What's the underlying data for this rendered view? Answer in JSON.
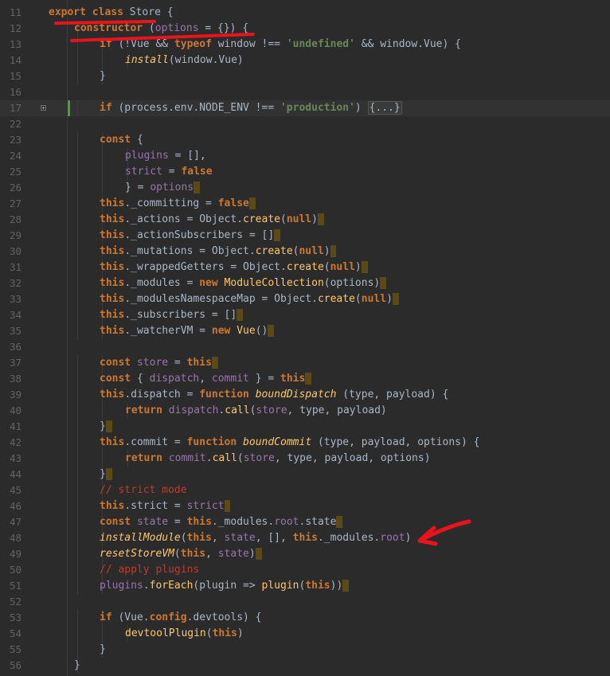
{
  "colors": {
    "background": "#2b2b2b",
    "keyword": "#cc7832",
    "string": "#6a8759",
    "function": "#ffc66d",
    "property": "#9876aa",
    "default_text": "#a9b7c6",
    "comment": "#bc3b2f",
    "line_number": "#606366",
    "annotation": "#e8131c"
  },
  "annotations": {
    "underline_class_label": "red underline",
    "underline_constructor_label": "red underline",
    "arrow_icon": "red-arrow-icon"
  },
  "lines": [
    {
      "num": "11",
      "indent": 0,
      "current": false,
      "tokens": [
        {
          "c": "k",
          "t": "export"
        },
        {
          "t": " "
        },
        {
          "c": "k",
          "t": "class"
        },
        {
          "t": " Store {"
        }
      ]
    },
    {
      "num": "12",
      "indent": 1,
      "current": false,
      "tokens": [
        {
          "c": "k",
          "t": "constructor"
        },
        {
          "t": " ("
        },
        {
          "c": "pr",
          "t": "options"
        },
        {
          "t": " = {}) {"
        }
      ]
    },
    {
      "num": "13",
      "indent": 2,
      "current": false,
      "tokens": [
        {
          "c": "k",
          "t": "if"
        },
        {
          "t": " (!Vue && "
        },
        {
          "c": "k",
          "t": "typeof"
        },
        {
          "t": " window !== "
        },
        {
          "c": "s",
          "t": "'undefined'"
        },
        {
          "t": " && window.Vue) {"
        }
      ]
    },
    {
      "num": "14",
      "indent": 3,
      "current": false,
      "tokens": [
        {
          "c": "fn it",
          "t": "install"
        },
        {
          "t": "(window.Vue)"
        }
      ]
    },
    {
      "num": "15",
      "indent": 2,
      "current": false,
      "tokens": [
        {
          "t": "}"
        }
      ]
    },
    {
      "num": "16",
      "indent": 0,
      "current": false,
      "tokens": []
    },
    {
      "num": "17",
      "indent": 2,
      "current": true,
      "fold": true,
      "change": true,
      "tokens": [
        {
          "c": "k",
          "t": "if"
        },
        {
          "t": " (process.env.NODE_ENV !== "
        },
        {
          "c": "s",
          "t": "'production'"
        },
        {
          "t": ") "
        },
        {
          "c": "fold-block",
          "t": "{...}"
        }
      ]
    },
    {
      "num": "22",
      "indent": 0,
      "current": false,
      "tokens": []
    },
    {
      "num": "23",
      "indent": 2,
      "current": false,
      "tokens": [
        {
          "c": "k",
          "t": "const"
        },
        {
          "t": " {"
        }
      ]
    },
    {
      "num": "24",
      "indent": 3,
      "current": false,
      "tokens": [
        {
          "c": "pr",
          "t": "plugins"
        },
        {
          "t": " = [],"
        }
      ]
    },
    {
      "num": "25",
      "indent": 3,
      "current": false,
      "tokens": [
        {
          "c": "pr",
          "t": "strict"
        },
        {
          "t": " = "
        },
        {
          "c": "k",
          "t": "false"
        }
      ]
    },
    {
      "num": "26",
      "indent": 3,
      "current": false,
      "tokens": [
        {
          "t": "} = "
        },
        {
          "c": "pr",
          "t": "options"
        },
        {
          "c": "ws",
          "t": " "
        }
      ]
    },
    {
      "num": "27",
      "indent": 2,
      "current": false,
      "tokens": [
        {
          "c": "k",
          "t": "this"
        },
        {
          "t": "._committing = "
        },
        {
          "c": "k",
          "t": "false"
        },
        {
          "c": "ws",
          "t": " "
        }
      ]
    },
    {
      "num": "28",
      "indent": 2,
      "current": false,
      "tokens": [
        {
          "c": "k",
          "t": "this"
        },
        {
          "t": "._actions = Object."
        },
        {
          "c": "fn",
          "t": "create"
        },
        {
          "t": "("
        },
        {
          "c": "k",
          "t": "null"
        },
        {
          "t": ")"
        },
        {
          "c": "ws",
          "t": " "
        }
      ]
    },
    {
      "num": "29",
      "indent": 2,
      "current": false,
      "tokens": [
        {
          "c": "k",
          "t": "this"
        },
        {
          "t": "._actionSubscribers = []"
        },
        {
          "c": "ws",
          "t": " "
        }
      ]
    },
    {
      "num": "30",
      "indent": 2,
      "current": false,
      "tokens": [
        {
          "c": "k",
          "t": "this"
        },
        {
          "t": "._mutations = Object."
        },
        {
          "c": "fn",
          "t": "create"
        },
        {
          "t": "("
        },
        {
          "c": "k",
          "t": "null"
        },
        {
          "t": ")"
        },
        {
          "c": "ws",
          "t": " "
        }
      ]
    },
    {
      "num": "31",
      "indent": 2,
      "current": false,
      "tokens": [
        {
          "c": "k",
          "t": "this"
        },
        {
          "t": "._wrappedGetters = Object."
        },
        {
          "c": "fn",
          "t": "create"
        },
        {
          "t": "("
        },
        {
          "c": "k",
          "t": "null"
        },
        {
          "t": ")"
        },
        {
          "c": "ws",
          "t": " "
        }
      ]
    },
    {
      "num": "32",
      "indent": 2,
      "current": false,
      "tokens": [
        {
          "c": "k",
          "t": "this"
        },
        {
          "t": "._modules = "
        },
        {
          "c": "k",
          "t": "new"
        },
        {
          "t": " "
        },
        {
          "c": "fn",
          "t": "ModuleCollection"
        },
        {
          "t": "(options)"
        },
        {
          "c": "ws",
          "t": " "
        }
      ]
    },
    {
      "num": "33",
      "indent": 2,
      "current": false,
      "tokens": [
        {
          "c": "k",
          "t": "this"
        },
        {
          "t": "._modulesNamespaceMap = Object."
        },
        {
          "c": "fn",
          "t": "create"
        },
        {
          "t": "("
        },
        {
          "c": "k",
          "t": "null"
        },
        {
          "t": ")"
        },
        {
          "c": "ws",
          "t": " "
        }
      ]
    },
    {
      "num": "34",
      "indent": 2,
      "current": false,
      "tokens": [
        {
          "c": "k",
          "t": "this"
        },
        {
          "t": "._subscribers = []"
        },
        {
          "c": "ws",
          "t": " "
        }
      ]
    },
    {
      "num": "35",
      "indent": 2,
      "current": false,
      "tokens": [
        {
          "c": "k",
          "t": "this"
        },
        {
          "t": "._watcherVM = "
        },
        {
          "c": "k",
          "t": "new"
        },
        {
          "t": " "
        },
        {
          "c": "fn",
          "t": "Vue"
        },
        {
          "t": "()"
        },
        {
          "c": "ws",
          "t": " "
        }
      ]
    },
    {
      "num": "36",
      "indent": 0,
      "current": false,
      "tokens": []
    },
    {
      "num": "37",
      "indent": 2,
      "current": false,
      "tokens": [
        {
          "c": "k",
          "t": "const"
        },
        {
          "t": " "
        },
        {
          "c": "pr",
          "t": "store"
        },
        {
          "t": " = "
        },
        {
          "c": "k",
          "t": "this"
        },
        {
          "c": "ws",
          "t": " "
        }
      ]
    },
    {
      "num": "38",
      "indent": 2,
      "current": false,
      "tokens": [
        {
          "c": "k",
          "t": "const"
        },
        {
          "t": " { "
        },
        {
          "c": "pr",
          "t": "dispatch"
        },
        {
          "t": ", "
        },
        {
          "c": "pr",
          "t": "commit"
        },
        {
          "t": " } = "
        },
        {
          "c": "k",
          "t": "this"
        },
        {
          "c": "ws",
          "t": " "
        }
      ]
    },
    {
      "num": "39",
      "indent": 2,
      "current": false,
      "tokens": [
        {
          "c": "k",
          "t": "this"
        },
        {
          "t": ".dispatch = "
        },
        {
          "c": "k",
          "t": "function"
        },
        {
          "t": " "
        },
        {
          "c": "fn it",
          "t": "boundDispatch"
        },
        {
          "t": " (type, payload) {"
        }
      ]
    },
    {
      "num": "40",
      "indent": 3,
      "current": false,
      "tokens": [
        {
          "c": "k",
          "t": "return"
        },
        {
          "t": " "
        },
        {
          "c": "pr",
          "t": "dispatch"
        },
        {
          "t": "."
        },
        {
          "c": "fn",
          "t": "call"
        },
        {
          "t": "("
        },
        {
          "c": "pr",
          "t": "store"
        },
        {
          "t": ", type, payload)"
        }
      ]
    },
    {
      "num": "41",
      "indent": 2,
      "current": false,
      "tokens": [
        {
          "t": "}"
        },
        {
          "c": "ws",
          "t": " "
        }
      ]
    },
    {
      "num": "42",
      "indent": 2,
      "current": false,
      "tokens": [
        {
          "c": "k",
          "t": "this"
        },
        {
          "t": ".commit = "
        },
        {
          "c": "k",
          "t": "function"
        },
        {
          "t": " "
        },
        {
          "c": "fn it",
          "t": "boundCommit"
        },
        {
          "t": " (type, payload, options) {"
        }
      ]
    },
    {
      "num": "43",
      "indent": 3,
      "current": false,
      "tokens": [
        {
          "c": "k",
          "t": "return"
        },
        {
          "t": " "
        },
        {
          "c": "pr",
          "t": "commit"
        },
        {
          "t": "."
        },
        {
          "c": "fn",
          "t": "call"
        },
        {
          "t": "("
        },
        {
          "c": "pr",
          "t": "store"
        },
        {
          "t": ", type, payload, options)"
        }
      ]
    },
    {
      "num": "44",
      "indent": 2,
      "current": false,
      "tokens": [
        {
          "t": "}"
        },
        {
          "c": "ws",
          "t": " "
        }
      ]
    },
    {
      "num": "45",
      "indent": 2,
      "current": false,
      "tokens": [
        {
          "c": "cm",
          "t": "// strict mode"
        }
      ]
    },
    {
      "num": "46",
      "indent": 2,
      "current": false,
      "tokens": [
        {
          "c": "k",
          "t": "this"
        },
        {
          "t": ".strict = "
        },
        {
          "c": "pr",
          "t": "strict"
        },
        {
          "c": "ws",
          "t": " "
        }
      ]
    },
    {
      "num": "47",
      "indent": 2,
      "current": false,
      "tokens": [
        {
          "c": "k",
          "t": "const"
        },
        {
          "t": " "
        },
        {
          "c": "pr",
          "t": "state"
        },
        {
          "t": " = "
        },
        {
          "c": "k",
          "t": "this"
        },
        {
          "t": "._modules."
        },
        {
          "c": "pr",
          "t": "root"
        },
        {
          "t": ".state"
        },
        {
          "c": "ws",
          "t": " "
        }
      ]
    },
    {
      "num": "48",
      "indent": 2,
      "current": false,
      "tokens": [
        {
          "c": "fn it",
          "t": "installModule"
        },
        {
          "t": "("
        },
        {
          "c": "k",
          "t": "this"
        },
        {
          "t": ", "
        },
        {
          "c": "pr",
          "t": "state"
        },
        {
          "t": ", [], "
        },
        {
          "c": "k",
          "t": "this"
        },
        {
          "t": "._modules."
        },
        {
          "c": "pr",
          "t": "root"
        },
        {
          "t": ")"
        }
      ]
    },
    {
      "num": "49",
      "indent": 2,
      "current": false,
      "tokens": [
        {
          "c": "fn it",
          "t": "resetStoreVM"
        },
        {
          "t": "("
        },
        {
          "c": "k",
          "t": "this"
        },
        {
          "t": ", "
        },
        {
          "c": "pr",
          "t": "state"
        },
        {
          "t": ")"
        },
        {
          "c": "ws",
          "t": " "
        }
      ]
    },
    {
      "num": "50",
      "indent": 2,
      "current": false,
      "tokens": [
        {
          "c": "cm",
          "t": "// apply plugins"
        }
      ]
    },
    {
      "num": "51",
      "indent": 2,
      "current": false,
      "tokens": [
        {
          "c": "pr",
          "t": "plugins"
        },
        {
          "t": "."
        },
        {
          "c": "fn",
          "t": "forEach"
        },
        {
          "t": "(plugin => "
        },
        {
          "c": "fn",
          "t": "plugin"
        },
        {
          "t": "("
        },
        {
          "c": "k",
          "t": "this"
        },
        {
          "t": "))"
        },
        {
          "c": "ws",
          "t": " "
        }
      ]
    },
    {
      "num": "52",
      "indent": 0,
      "current": false,
      "tokens": []
    },
    {
      "num": "53",
      "indent": 2,
      "current": false,
      "tokens": [
        {
          "c": "k",
          "t": "if"
        },
        {
          "t": " (Vue."
        },
        {
          "c": "k",
          "t": "config"
        },
        {
          "t": ".devtools) {"
        }
      ]
    },
    {
      "num": "54",
      "indent": 3,
      "current": false,
      "tokens": [
        {
          "c": "fn",
          "t": "devtoolPlugin"
        },
        {
          "t": "("
        },
        {
          "c": "k",
          "t": "this"
        },
        {
          "t": ")"
        }
      ]
    },
    {
      "num": "55",
      "indent": 2,
      "current": false,
      "tokens": [
        {
          "t": "}"
        }
      ]
    },
    {
      "num": "56",
      "indent": 1,
      "current": false,
      "tokens": [
        {
          "t": "}"
        }
      ]
    }
  ]
}
